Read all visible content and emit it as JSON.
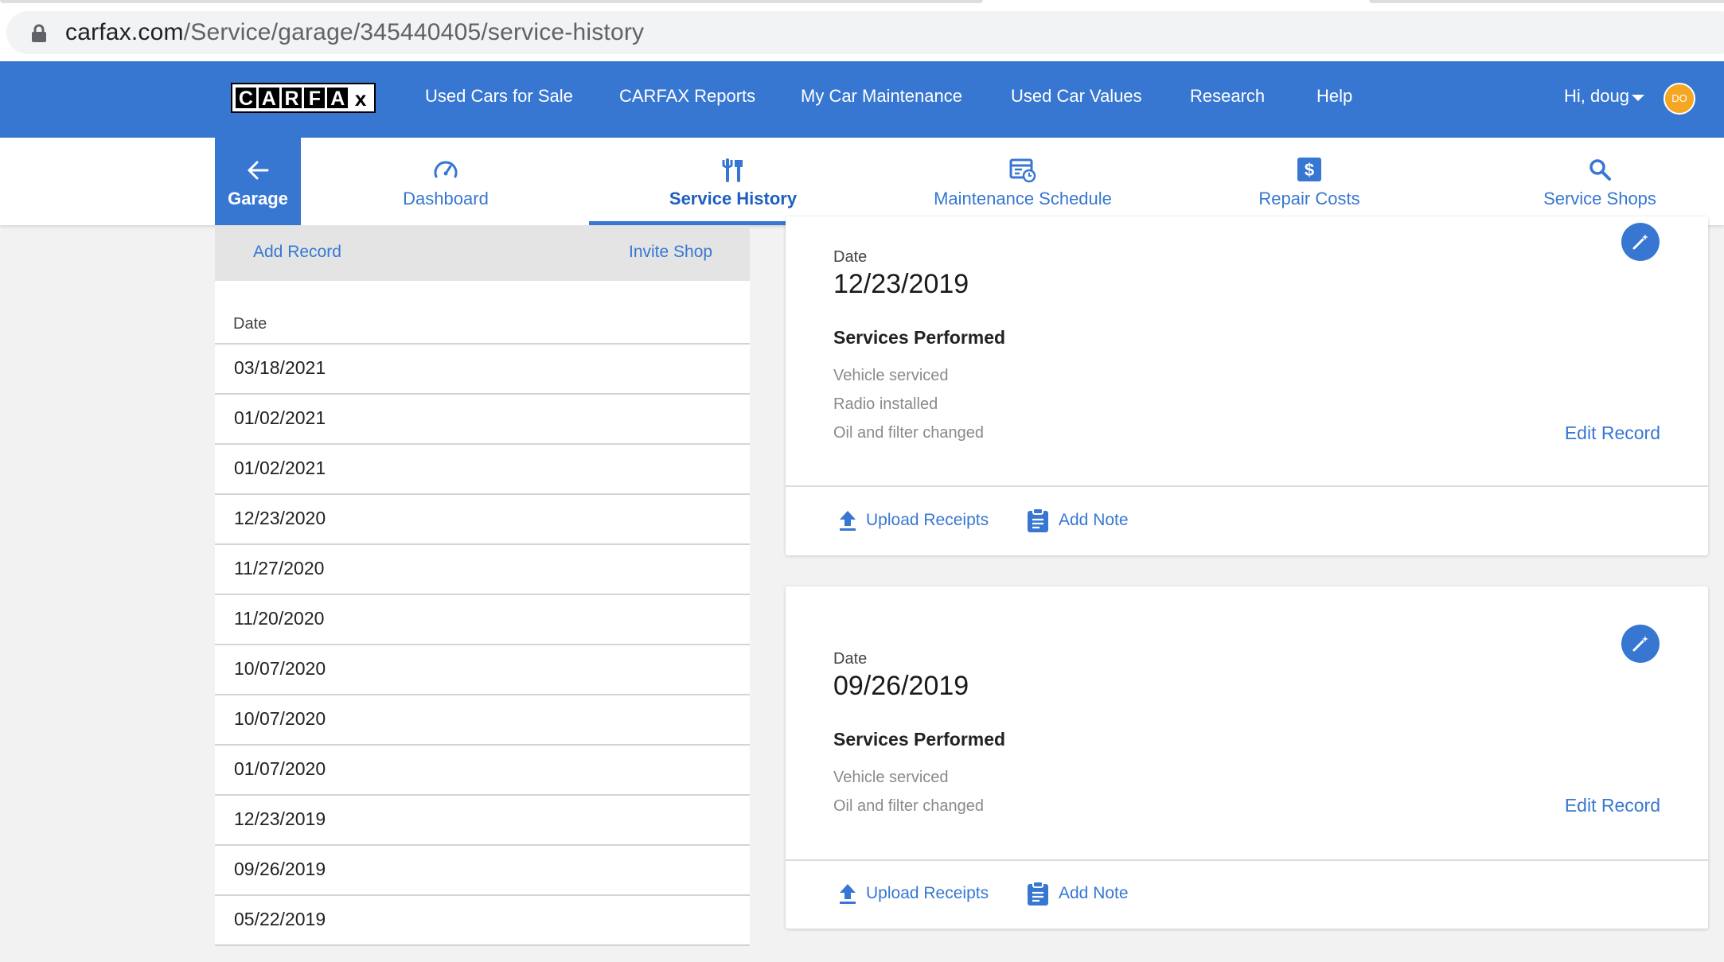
{
  "browser": {
    "url_host": "carfax.com",
    "url_path": "/Service/garage/345440405/service-history"
  },
  "topnav": {
    "logo_letters": [
      "C",
      "A",
      "R",
      "F",
      "A",
      "x"
    ],
    "links": [
      "Used Cars for Sale",
      "CARFAX Reports",
      "My Car Maintenance",
      "Used Car Values",
      "Research",
      "Help"
    ],
    "greeting": "Hi, doug",
    "avatar_initials": "DO"
  },
  "subnav": {
    "back_label": "Garage",
    "tabs": [
      "Dashboard",
      "Service History",
      "Maintenance Schedule",
      "Repair Costs",
      "Service Shops"
    ],
    "active_tab": "Service History"
  },
  "left_panel": {
    "add_record": "Add Record",
    "invite_shop": "Invite Shop",
    "date_header": "Date",
    "dates": [
      "03/18/2021",
      "01/02/2021",
      "01/02/2021",
      "12/23/2020",
      "11/27/2020",
      "11/20/2020",
      "10/07/2020",
      "10/07/2020",
      "01/07/2020",
      "12/23/2019",
      "09/26/2019",
      "05/22/2019"
    ]
  },
  "records": [
    {
      "date_label": "Date",
      "date": "12/23/2019",
      "services_title": "Services Performed",
      "services": [
        "Vehicle serviced",
        "Radio installed",
        "Oil and filter changed"
      ],
      "edit_label": "Edit Record",
      "upload_label": "Upload Receipts",
      "note_label": "Add Note"
    },
    {
      "date_label": "Date",
      "date": "09/26/2019",
      "services_title": "Services Performed",
      "services": [
        "Vehicle serviced",
        "Oil and filter changed"
      ],
      "edit_label": "Edit Record",
      "upload_label": "Upload Receipts",
      "note_label": "Add Note"
    }
  ],
  "colors": {
    "brand_blue": "#3777d2",
    "avatar": "#f5a623"
  }
}
